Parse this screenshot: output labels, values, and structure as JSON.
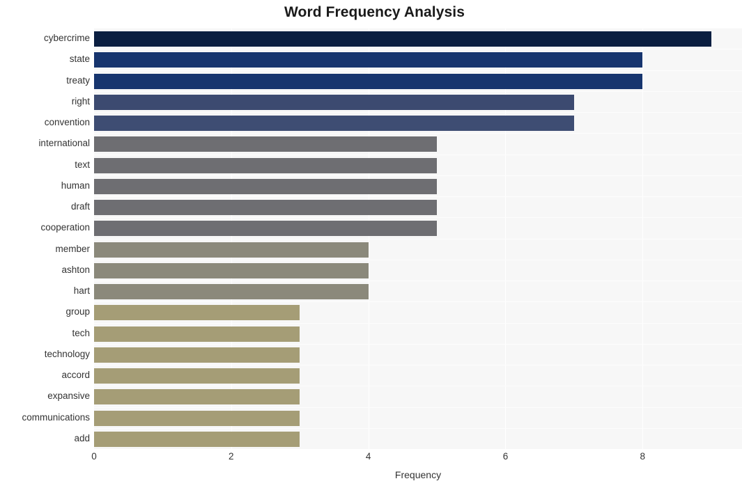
{
  "chart_data": {
    "type": "bar",
    "orientation": "horizontal",
    "title": "Word Frequency Analysis",
    "xlabel": "Frequency",
    "ylabel": "",
    "xlim": [
      0,
      9.45
    ],
    "xticks": [
      0,
      2,
      4,
      6,
      8
    ],
    "xtick_labels": [
      "0",
      "2",
      "4",
      "6",
      "8"
    ],
    "grid": true,
    "grid_axis": "both",
    "legend": "none",
    "plot_background": "#f7f7f7",
    "categories": [
      "cybercrime",
      "state",
      "treaty",
      "right",
      "convention",
      "international",
      "text",
      "human",
      "draft",
      "cooperation",
      "member",
      "ashton",
      "hart",
      "group",
      "tech",
      "technology",
      "accord",
      "expansive",
      "communications",
      "add"
    ],
    "values": [
      9,
      8,
      8,
      7,
      7,
      5,
      5,
      5,
      5,
      5,
      4,
      4,
      4,
      3,
      3,
      3,
      3,
      3,
      3,
      3
    ],
    "bar_colors": [
      "#0b1f41",
      "#17356e",
      "#17356e",
      "#3c4a70",
      "#3e4d73",
      "#6e6e72",
      "#6e6e72",
      "#6e6e72",
      "#6e6e72",
      "#6e6e72",
      "#8b897b",
      "#8b897b",
      "#8b897b",
      "#a59d76",
      "#a59d76",
      "#a59d76",
      "#a59d76",
      "#a59d76",
      "#a59d76",
      "#a59d76"
    ]
  }
}
